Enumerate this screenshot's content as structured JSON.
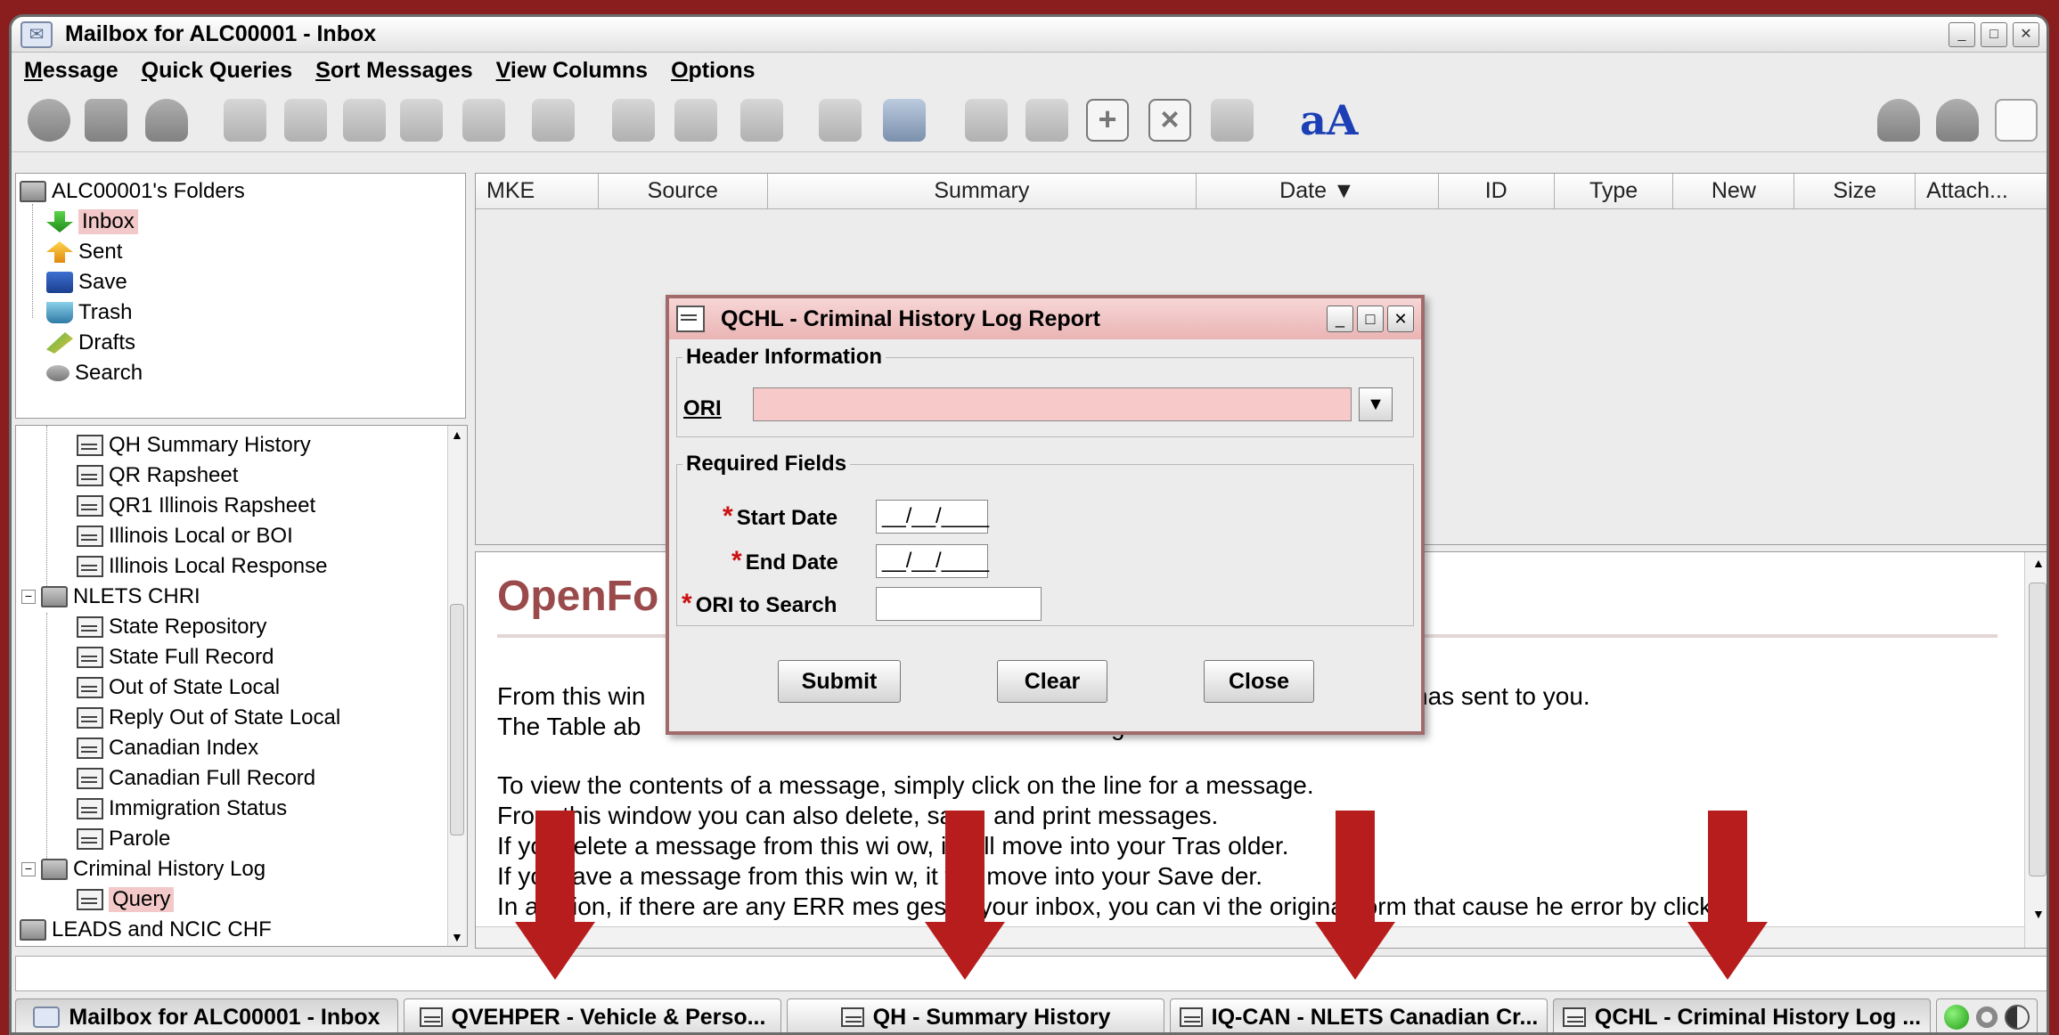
{
  "window": {
    "title": "Mailbox for ALC00001 - Inbox"
  },
  "menu": [
    "Message",
    "Quick Queries",
    "Sort Messages",
    "View Columns",
    "Options"
  ],
  "folders": {
    "root": "ALC00001's Folders",
    "items": [
      "Inbox",
      "Sent",
      "Save",
      "Trash",
      "Drafts",
      "Search"
    ],
    "selected": "Inbox"
  },
  "tree": {
    "group1_items": [
      "QH Summary History",
      "QR Rapsheet",
      "QR1 Illinois Rapsheet",
      "Illinois Local or BOI",
      "Illinois Local Response"
    ],
    "nlets": {
      "label": "NLETS CHRI",
      "items": [
        "State Repository",
        "State Full Record",
        "Out of State Local",
        "Reply Out of State Local",
        "Canadian Index",
        "Canadian Full Record",
        "Immigration Status",
        "Parole"
      ]
    },
    "chl": {
      "label": "Criminal History Log",
      "items": [
        "Query"
      ]
    },
    "leads": "LEADS and NCIC CHF"
  },
  "columns": [
    "MKE",
    "Source",
    "Summary",
    "Date",
    "ID",
    "Type",
    "New",
    "Size",
    "Attach..."
  ],
  "sort_indicator": "▼",
  "preview": {
    "heading": "OpenFo",
    "lines": [
      "From this win",
      "The Table ab",
      "To view the contents of a message, simply click on the line for a message.",
      "From this window you can also delete, save, and print messages.",
      "If yo",
      "If yo",
      "In a"
    ],
    "line_tails": [
      "has sent to you.",
      "g",
      "",
      "",
      "delete a message from this wi      ow, it will move into your Tras       older.",
      "save a message from this win       w, it will move into your Save       der.",
      "ition, if there are any ERR mes      ges in your inbox, you can vi     the original form that cause      he error by clicking"
    ]
  },
  "dialog": {
    "title": "QCHL - Criminal History Log Report",
    "header_legend": "Header Information",
    "ori_label": "ORI",
    "ori_value": "",
    "required_legend": "Required Fields",
    "start_date_label": "Start Date",
    "start_date_value": "__/__/____",
    "end_date_label": "End Date",
    "end_date_value": "__/__/____",
    "ori_search_label": "ORI to Search",
    "ori_search_value": "",
    "required_marker": "*",
    "buttons": {
      "submit": "Submit",
      "clear": "Clear",
      "close": "Close"
    }
  },
  "taskbar": [
    "Mailbox for ALC00001 - Inbox",
    "QVEHPER - Vehicle & Perso...",
    "QH - Summary History",
    "IQ-CAN - NLETS Canadian Cr...",
    "QCHL - Criminal History Log ..."
  ],
  "colors": {
    "accent_red": "#b81d1d",
    "selection_pink": "#f2c8c8",
    "dialog_title": "#eab4b4"
  }
}
